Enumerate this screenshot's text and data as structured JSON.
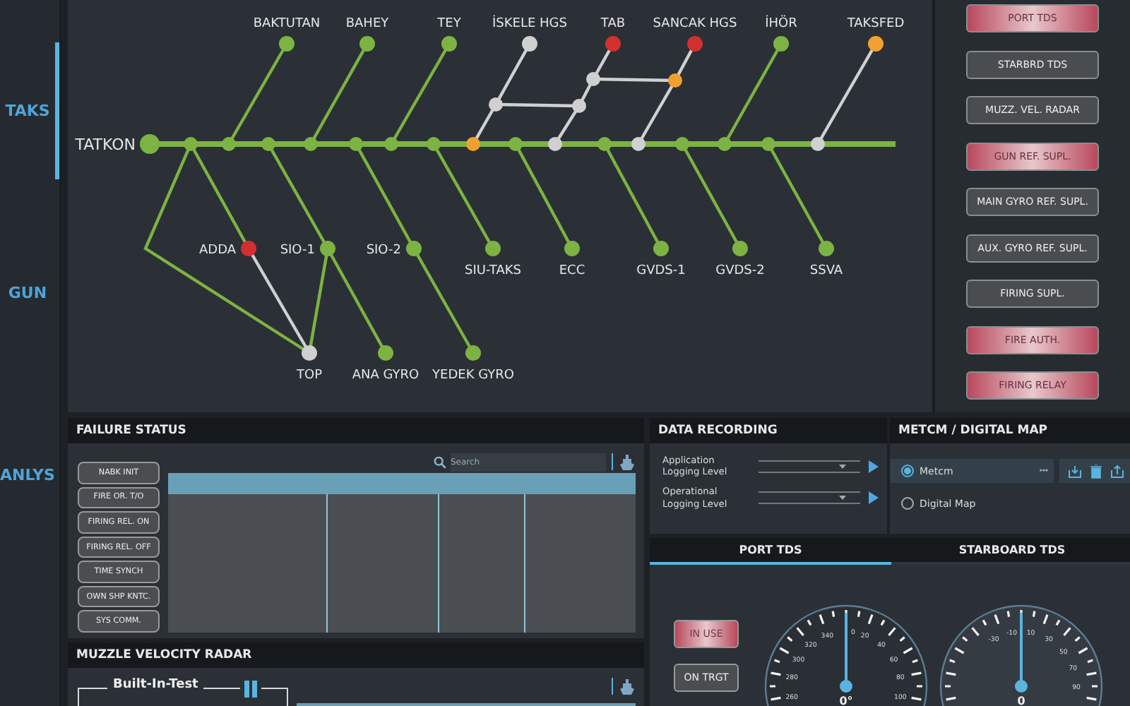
{
  "nav": [
    {
      "label": "TAKS",
      "selected": true
    },
    {
      "label": "GUN",
      "selected": false
    },
    {
      "label": "ANLYS",
      "selected": false
    }
  ],
  "diagram": {
    "root": "TATKON",
    "junctions": [
      {
        "color": "#7cb342"
      },
      {
        "color": "#7cb342"
      },
      {
        "color": "#7cb342"
      },
      {
        "color": "#7cb342"
      },
      {
        "color": "#7cb342"
      },
      {
        "color": "#7cb342"
      },
      {
        "color": "#7cb342"
      },
      {
        "color": "#f0a030"
      },
      {
        "color": "#7cb342"
      },
      {
        "color": "#d0d0d0"
      },
      {
        "color": "#7cb342"
      },
      {
        "color": "#d0d0d0"
      },
      {
        "color": "#7cb342"
      },
      {
        "color": "#7cb342"
      },
      {
        "color": "#7cb342"
      },
      {
        "color": "#d0d0d0"
      },
      {
        "color": "#d0d0d0"
      },
      {
        "color": "#d0d0d0"
      },
      {
        "color": "#d0d0d0"
      },
      {
        "color": "#f0a030"
      }
    ],
    "nodes": [
      {
        "label": "BAKTUTAN",
        "color": "#7cb342"
      },
      {
        "label": "BAHEY",
        "color": "#7cb342"
      },
      {
        "label": "TEY",
        "color": "#7cb342"
      },
      {
        "label": "İSKELE HGS",
        "color": "#d0d0d0"
      },
      {
        "label": "TAB",
        "color": "#d32f2f"
      },
      {
        "label": "SANCAK HGS",
        "color": "#d32f2f"
      },
      {
        "label": "İHÖR",
        "color": "#7cb342"
      },
      {
        "label": "TAKSFED",
        "color": "#f0a030"
      },
      {
        "label": "ADDA",
        "color": "#d32f2f"
      },
      {
        "label": "SIO-1",
        "color": "#7cb342"
      },
      {
        "label": "SIO-2",
        "color": "#7cb342"
      },
      {
        "label": "SIU-TAKS",
        "color": "#7cb342"
      },
      {
        "label": "ECC",
        "color": "#7cb342"
      },
      {
        "label": "GVDS-1",
        "color": "#7cb342"
      },
      {
        "label": "GVDS-2",
        "color": "#7cb342"
      },
      {
        "label": "SSVA",
        "color": "#7cb342"
      },
      {
        "label": "TOP",
        "color": "#d0d0d0"
      },
      {
        "label": "ANA GYRO",
        "color": "#7cb342"
      },
      {
        "label": "YEDEK GYRO",
        "color": "#7cb342"
      }
    ],
    "links": [
      {
        "color": "#7cb342"
      },
      {
        "color": "#7cb342"
      },
      {
        "color": "#7cb342"
      },
      {
        "color": "#d0d0d0"
      },
      {
        "color": "#d0d0d0"
      },
      {
        "color": "#d0d0d0"
      },
      {
        "color": "#d0d0d0"
      },
      {
        "color": "#d0d0d0"
      },
      {
        "color": "#d0d0d0"
      },
      {
        "color": "#d0d0d0"
      },
      {
        "color": "#d0d0d0"
      },
      {
        "color": "#d0d0d0"
      },
      {
        "color": "#7cb342"
      },
      {
        "color": "#d0d0d0"
      },
      {
        "color": "#7cb342"
      },
      {
        "color": "#7cb342"
      },
      {
        "color": "#d0d0d0"
      },
      {
        "color": "#7cb342"
      },
      {
        "color": "#7cb342"
      },
      {
        "color": "#7cb342"
      },
      {
        "color": "#7cb342"
      },
      {
        "color": "#7cb342"
      },
      {
        "color": "#7cb342"
      },
      {
        "color": "#7cb342"
      },
      {
        "color": "#7cb342"
      },
      {
        "color": "#7cb342"
      },
      {
        "color": "#7cb342"
      }
    ]
  },
  "system_buttons": [
    {
      "label": "PORT TDS",
      "alarm": true
    },
    {
      "label": "STARBRD TDS",
      "alarm": false
    },
    {
      "label": "MUZZ. VEL. RADAR",
      "alarm": false
    },
    {
      "label": "GUN REF. SUPL.",
      "alarm": true
    },
    {
      "label": "MAIN GYRO REF. SUPL.",
      "alarm": false
    },
    {
      "label": "AUX. GYRO REF. SUPL.",
      "alarm": false
    },
    {
      "label": "FIRING SUPL.",
      "alarm": false
    },
    {
      "label": "FIRE AUTH.",
      "alarm": true
    },
    {
      "label": "FIRING RELAY",
      "alarm": true
    }
  ],
  "failure_status": {
    "title": "FAILURE STATUS",
    "buttons": [
      "NABK INIT",
      "FIRE OR. T/O",
      "FIRING REL. ON",
      "FIRING REL. OFF",
      "TIME SYNCH",
      "OWN SHP KNTC.",
      "SYS COMM."
    ],
    "search": {
      "placeholder": "Search"
    }
  },
  "muzzle_velocity_radar": {
    "title": "MUZZLE VELOCITY RADAR",
    "group_title": "Built-In-Test"
  },
  "data_recording": {
    "title": "DATA RECORDING",
    "rows": [
      {
        "label": "Application Logging Level"
      },
      {
        "label": "Operational Logging Level"
      }
    ]
  },
  "metcm": {
    "title": "METCM / DIGITAL MAP",
    "options": [
      {
        "label": "Metcm",
        "selected": true
      },
      {
        "label": "Digital Map",
        "selected": false
      }
    ],
    "more": "•••"
  },
  "tds": {
    "tabs": [
      {
        "label": "PORT TDS",
        "selected": true
      },
      {
        "label": "STARBOARD TDS",
        "selected": false
      }
    ],
    "buttons": [
      {
        "label": "IN USE",
        "alarm": true
      },
      {
        "label": "ON TRGT",
        "alarm": false
      }
    ],
    "gauges": [
      {
        "labels": [
          "260",
          "280",
          "300",
          "320",
          "340",
          "0",
          "20",
          "40",
          "60",
          "80",
          "100"
        ],
        "reading": "0°"
      },
      {
        "labels": [
          "-30",
          "-10",
          "10",
          "30",
          "50",
          "70",
          "90"
        ],
        "reading": "0"
      }
    ]
  }
}
